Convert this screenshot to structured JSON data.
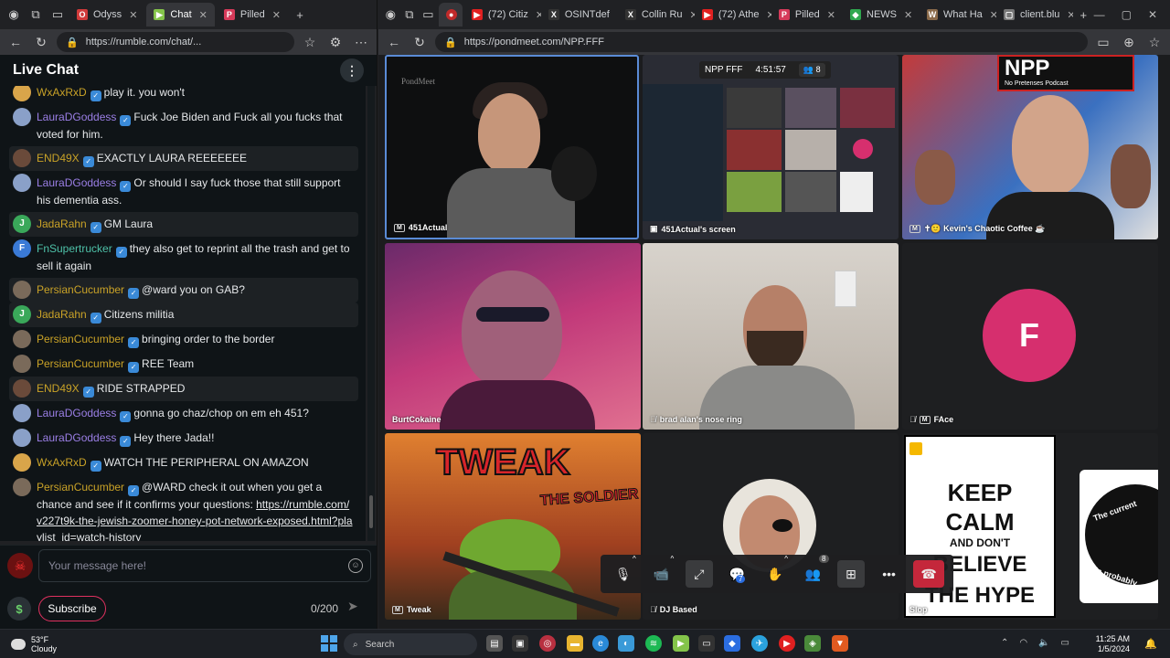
{
  "left_browser": {
    "tabs": [
      {
        "label": "Odyss",
        "fav_color": "#d13a3a",
        "fav": "O"
      },
      {
        "label": "Chat",
        "fav_color": "#84c44a",
        "fav": "▶",
        "active": true
      },
      {
        "label": "Pilled",
        "fav_color": "#d63a5a",
        "fav": "P"
      }
    ],
    "url": "https://rumble.com/chat/..."
  },
  "chat": {
    "title": "Live Chat",
    "messages": [
      {
        "user": "WxAxRxD",
        "color": "#c9a227",
        "text": "play it. you won't",
        "av_color": "#d9a54a",
        "hl": false
      },
      {
        "user": "LauraDGoddess",
        "color": "#9b7fe6",
        "text": "Fuck Joe Biden and Fuck all you fucks that voted for him.",
        "av_color": "#8aa0c8",
        "hl": false
      },
      {
        "user": "END49X",
        "color": "#c9a227",
        "text": "EXACTLY LAURA REEEEEEE",
        "av_color": "#6a4a3a",
        "hl": true
      },
      {
        "user": "LauraDGoddess",
        "color": "#9b7fe6",
        "text": "Or should I say fuck those that still support his dementia ass.",
        "av_color": "#8aa0c8",
        "hl": false
      },
      {
        "user": "JadaRahn",
        "color": "#c9a227",
        "text": "GM Laura",
        "av_color": "#3aa85a",
        "av_letter": "J",
        "hl": true
      },
      {
        "user": "FnSupertrucker",
        "color": "#4ec1a8",
        "text": "they also get to reprint all the trash and get to sell it again",
        "av_color": "#3a7ad6",
        "av_letter": "F",
        "hl": false
      },
      {
        "user": "PersianCucumber",
        "color": "#c9a227",
        "text": "@ward you on GAB?",
        "av_color": "#7a6a5a",
        "hl": true
      },
      {
        "user": "JadaRahn",
        "color": "#c9a227",
        "text": "Citizens militia",
        "av_color": "#3aa85a",
        "av_letter": "J",
        "hl": true
      },
      {
        "user": "PersianCucumber",
        "color": "#c9a227",
        "text": "bringing order to the border",
        "av_color": "#7a6a5a",
        "hl": false
      },
      {
        "user": "PersianCucumber",
        "color": "#c9a227",
        "text": "REE Team",
        "av_color": "#7a6a5a",
        "hl": false
      },
      {
        "user": "END49X",
        "color": "#c9a227",
        "text": "RIDE STRAPPED",
        "av_color": "#6a4a3a",
        "hl": true
      },
      {
        "user": "LauraDGoddess",
        "color": "#9b7fe6",
        "text": "gonna go chaz/chop on em eh 451?",
        "av_color": "#8aa0c8",
        "hl": false
      },
      {
        "user": "LauraDGoddess",
        "color": "#9b7fe6",
        "text": "Hey there Jada!!",
        "av_color": "#8aa0c8",
        "hl": false
      },
      {
        "user": "WxAxRxD",
        "color": "#c9a227",
        "text": "WATCH THE PERIPHERAL ON AMAZON",
        "av_color": "#d9a54a",
        "hl": false
      },
      {
        "user": "PersianCucumber",
        "color": "#c9a227",
        "text": "@WARD check it out when you get a chance and see if it confirms your questions: ",
        "link": "https://rumble.com/v227t9k-the-jewish-zoomer-honey-pot-network-exposed.html?playlist_id=watch-history",
        "av_color": "#7a6a5a",
        "hl": false
      }
    ],
    "input_placeholder": "Your message here!",
    "subscribe_label": "Subscribe",
    "char_count": "0/200",
    "dollar": "$"
  },
  "right_browser": {
    "tabs": [
      {
        "label": "(72) Citiz",
        "fav_color": "#e02020",
        "fav": "▶"
      },
      {
        "label": "OSINTdef",
        "fav_color": "#333333",
        "fav": "X"
      },
      {
        "label": "Collin Ru",
        "fav_color": "#333333",
        "fav": "X"
      },
      {
        "label": "(72) Athe",
        "fav_color": "#e02020",
        "fav": "▶"
      },
      {
        "label": "Pilled",
        "fav_color": "#d63a5a",
        "fav": "P"
      },
      {
        "label": "NEWS",
        "fav_color": "#2fa84f",
        "fav": "◆"
      },
      {
        "label": "What Ha",
        "fav_color": "#8a6a4a",
        "fav": "W"
      },
      {
        "label": "client.blu",
        "fav_color": "#777777",
        "fav": "▢"
      }
    ],
    "url": "https://pondmeet.com/NPP.FFF"
  },
  "meeting": {
    "room_name": "NPP FFF",
    "timer": "4:51:57",
    "participant_count": "8",
    "tiles": {
      "t1": {
        "name": "451Actual",
        "watermark": "PondMeet"
      },
      "t2": {
        "name": "451Actual's screen"
      },
      "t3": {
        "name": "✝🙂 Kevin's Chaotic Coffee ☕",
        "logo_text": "NPP",
        "logo_sub": "No Pretenses Podcast"
      },
      "t4": {
        "name": "BurtCokaine"
      },
      "t5": {
        "name": "brad alan's nose ring"
      },
      "t6": {
        "name": "FAce",
        "initial": "F"
      },
      "t7": {
        "name": "Tweak",
        "title1": "TWEAK",
        "title2": "THE SOLDIER"
      },
      "t8": {
        "name": "DJ Based"
      },
      "t9": {
        "name": "Slop",
        "poster": [
          "KEEP",
          "CALM",
          "AND DON'T",
          "BELIEVE",
          "THE HYPE"
        ],
        "side_text": "The current",
        "side_text2": "Is probably"
      }
    },
    "controls": {
      "chat_badge": "7",
      "people_badge": "8"
    }
  },
  "taskbar": {
    "temp": "53°F",
    "weather": "Cloudy",
    "search": "Search",
    "time": "11:25 AM",
    "date": "1/5/2024"
  }
}
